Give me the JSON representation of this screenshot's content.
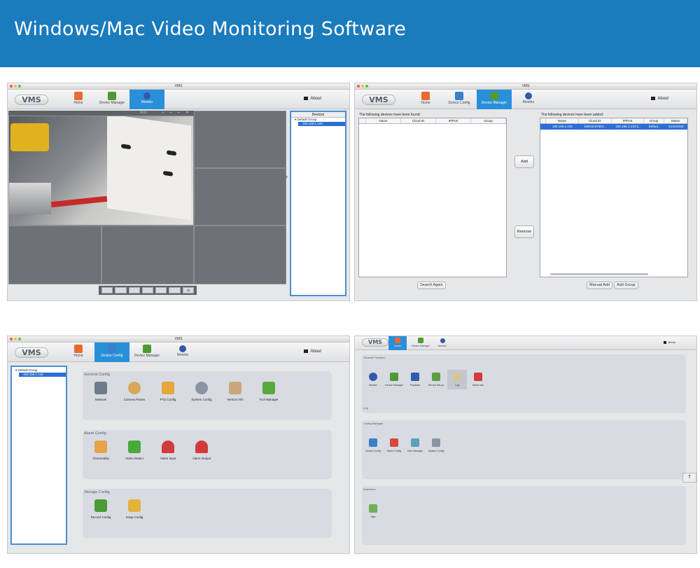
{
  "banner": {
    "title": "Windows/Mac Video Monitoring Software"
  },
  "common": {
    "window_title": "VMS",
    "logo": "VMS",
    "about": "About",
    "toolbar": {
      "home": "Home",
      "device_config": "Device Config",
      "device_manager": "Device Manager",
      "monitor": "Monitor"
    }
  },
  "monitor": {
    "active_tab": "Monitor",
    "status": "Auto",
    "devices_title": "Devices",
    "tree": {
      "group": "Default Group",
      "device": "192.168.1.134"
    },
    "layout_options": [
      "1",
      "4",
      "6",
      "8",
      "9",
      "16",
      "25"
    ],
    "layout_last_label": "25"
  },
  "device_manager": {
    "found_label": "The following devices have been found:",
    "added_label": "The following devices have been added:",
    "found_columns": [
      "Name",
      "Cloud ID",
      "IP/Port",
      "Group"
    ],
    "added_columns": [
      "Name",
      "Cloud ID",
      "IP/Port",
      "Group",
      "Status"
    ],
    "added_rows": [
      {
        "name": "192.168.1.134",
        "cloud_id": "b60c6197824...",
        "ip_port": "192.168.1.134:3...",
        "group": "Defaul...",
        "status": "Connected"
      }
    ],
    "add_button": "Add",
    "remove_button": "Remove",
    "search_again": "Search Again",
    "manual_add": "Manual Add",
    "add_group": "Add Group"
  },
  "device_config": {
    "tree": {
      "group": "Default Group",
      "device": "192.168.1.134"
    },
    "general": {
      "title": "General Config",
      "items": [
        "Network",
        "Camera Param",
        "PTZ Config",
        "System Config",
        "Version Info",
        "Tool Manager"
      ]
    },
    "alarm": {
      "title": "Alarm Config",
      "items": [
        "Abnormality",
        "Video Detect",
        "Alarm Input",
        "Alarm Output"
      ]
    },
    "storage": {
      "title": "Storage Config",
      "items": [
        "Record Config",
        "Snap Config"
      ]
    }
  },
  "home": {
    "logo": "VMS",
    "about": "About",
    "toolbar": {
      "home": "Home",
      "device_manager": "Device Manager",
      "monitor": "Monitor"
    },
    "general": {
      "title": "General Function",
      "items": [
        "Monitor",
        "Device Manager",
        "Playback",
        "Record Set-up",
        "Log",
        "Alarm Info"
      ],
      "footer": "Log"
    },
    "config": {
      "title": "Config Manager",
      "items": [
        "Device Config",
        "Alarm Config",
        "User Manager",
        "System Config"
      ]
    },
    "extra": {
      "title": "Extension",
      "items": [
        "Map"
      ]
    },
    "side_button": "T"
  },
  "colors": {
    "banner": "#1a7bbd",
    "accent": "#2a8fd9",
    "selection": "#2a6fd1"
  }
}
